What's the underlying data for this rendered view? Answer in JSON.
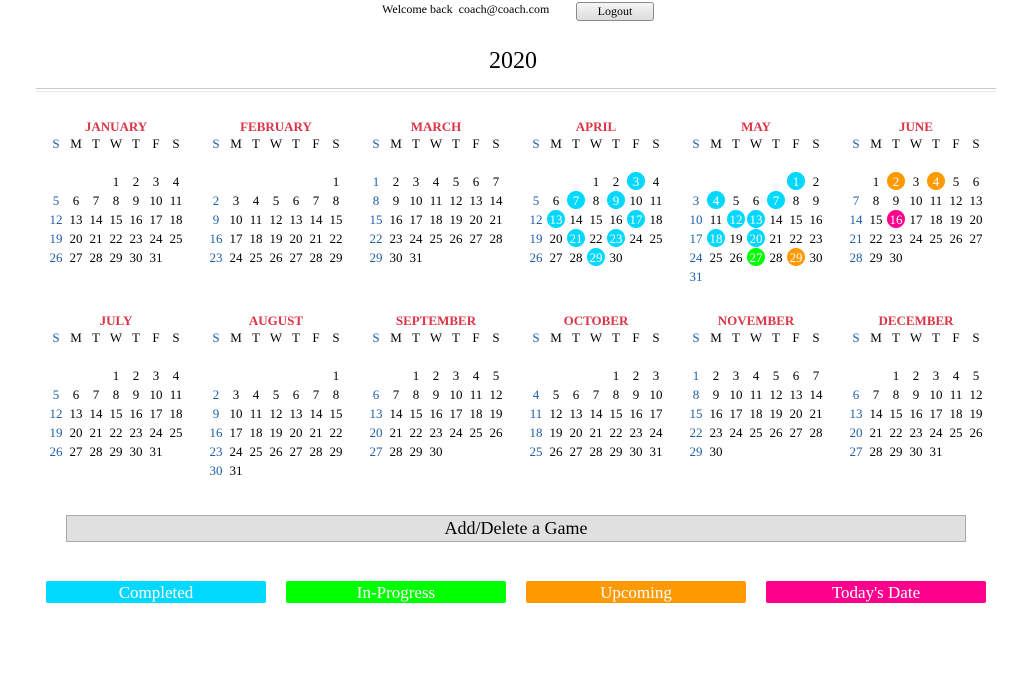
{
  "header": {
    "welcome_prefix": "Welcome back",
    "user_email": "coach@coach.com",
    "logout_label": "Logout"
  },
  "calendar": {
    "year": "2020",
    "weekday_labels": [
      "S",
      "M",
      "T",
      "W",
      "T",
      "F",
      "S"
    ],
    "status_colors": {
      "completed": "#00d8ff",
      "in_progress": "#00ff00",
      "upcoming": "#ff9900",
      "today": "#ff008c"
    },
    "months": [
      {
        "name": "JANUARY",
        "first_weekday": 3,
        "days": 31,
        "marks": {}
      },
      {
        "name": "FEBRUARY",
        "first_weekday": 6,
        "days": 29,
        "marks": {}
      },
      {
        "name": "MARCH",
        "first_weekday": 0,
        "days": 31,
        "marks": {}
      },
      {
        "name": "APRIL",
        "first_weekday": 3,
        "days": 30,
        "marks": {
          "3": "completed",
          "7": "completed",
          "9": "completed",
          "13": "completed",
          "17": "completed",
          "21": "completed",
          "23": "completed",
          "29": "completed"
        }
      },
      {
        "name": "MAY",
        "first_weekday": 5,
        "days": 31,
        "marks": {
          "1": "completed",
          "4": "completed",
          "7": "completed",
          "12": "completed",
          "13": "completed",
          "18": "completed",
          "20": "completed",
          "27": "in_progress",
          "29": "upcoming"
        }
      },
      {
        "name": "JUNE",
        "first_weekday": 1,
        "days": 30,
        "marks": {
          "2": "upcoming",
          "4": "upcoming",
          "16": "today"
        }
      },
      {
        "name": "JULY",
        "first_weekday": 3,
        "days": 31,
        "marks": {}
      },
      {
        "name": "AUGUST",
        "first_weekday": 6,
        "days": 31,
        "marks": {}
      },
      {
        "name": "SEPTEMBER",
        "first_weekday": 2,
        "days": 30,
        "marks": {}
      },
      {
        "name": "OCTOBER",
        "first_weekday": 4,
        "days": 31,
        "marks": {}
      },
      {
        "name": "NOVEMBER",
        "first_weekday": 0,
        "days": 30,
        "marks": {}
      },
      {
        "name": "DECEMBER",
        "first_weekday": 2,
        "days": 31,
        "marks": {}
      }
    ]
  },
  "actions": {
    "add_delete_label": "Add/Delete a Game"
  },
  "legend": {
    "completed": "Completed",
    "in_progress": "In-Progress",
    "upcoming": "Upcoming",
    "today": "Today's Date"
  }
}
